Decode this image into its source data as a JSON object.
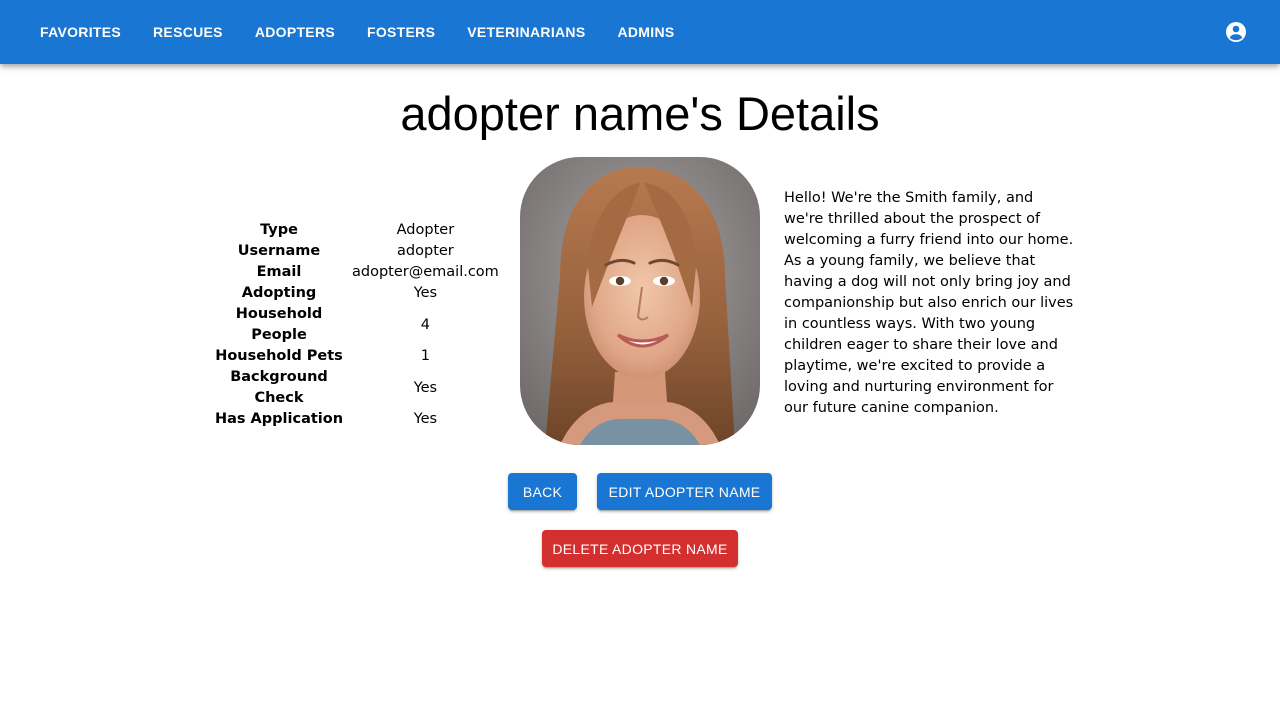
{
  "nav": {
    "items": [
      {
        "label": "FAVORITES"
      },
      {
        "label": "RESCUES"
      },
      {
        "label": "ADOPTERS"
      },
      {
        "label": "FOSTERS"
      },
      {
        "label": "VETERINARIANS"
      },
      {
        "label": "ADMINS"
      }
    ],
    "account_icon": "account-circle-icon"
  },
  "page": {
    "title": "adopter name's Details"
  },
  "details": [
    {
      "key": "Type",
      "value": "Adopter"
    },
    {
      "key": "Username",
      "value": "adopter"
    },
    {
      "key": "Email",
      "value": "adopter@email.com"
    },
    {
      "key": "Adopting",
      "value": "Yes"
    },
    {
      "key": "Household People",
      "value": "4"
    },
    {
      "key": "Household Pets",
      "value": "1"
    },
    {
      "key": "Background Check",
      "value": "Yes"
    },
    {
      "key": "Has Application",
      "value": "Yes"
    }
  ],
  "bio": "Hello! We're the Smith family, and we're thrilled about the prospect of welcoming a furry friend into our home. As a young family, we believe that having a dog will not only bring joy and companionship but also enrich our lives in countless ways. With two young children eager to share their love and playtime, we're excited to provide a loving and nurturing environment for our future canine companion.",
  "actions": {
    "back_label": "BACK",
    "edit_label": "EDIT ADOPTER NAME",
    "delete_label": "DELETE ADOPTER NAME"
  },
  "colors": {
    "primary": "#1976d2",
    "danger": "#d32f2f"
  }
}
